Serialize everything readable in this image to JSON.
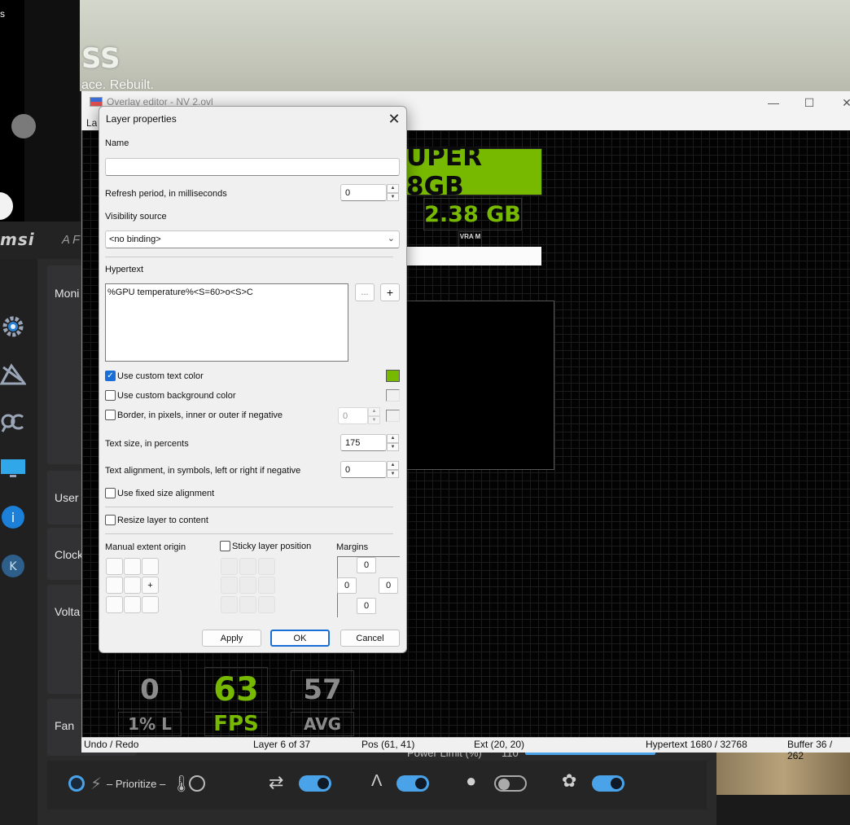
{
  "background": {
    "left_text": "s",
    "photo_title": "SS",
    "photo_subtitle": "ace. Rebuilt."
  },
  "msi": {
    "logo": "msi",
    "app_short": "AF",
    "sidebar_icons": [
      "gear-icon",
      "tool-icon",
      "search-icon",
      "monitor-icon",
      "info-icon",
      "k-icon"
    ],
    "cards": [
      "Moni",
      "User I",
      "Clock",
      "Volta",
      "Fan"
    ],
    "power_limit_label": "Power Limit (%)",
    "power_limit_value": "110",
    "prioritize_label": "– Prioritize –",
    "toggles": [
      true,
      true,
      false,
      true
    ],
    "accent": "#4aa3e8"
  },
  "overlay_editor": {
    "title": "Overlay editor - NV 2.ovl",
    "menu_label": "La",
    "window_buttons": [
      "minimize",
      "maximize",
      "close"
    ],
    "layers": {
      "super": "UPER 8GB",
      "gb": "2.38 GB",
      "vram": "VRA M",
      "stat_values": [
        "0",
        "63",
        "57"
      ],
      "stat_labels": [
        "1% L",
        "FPS",
        "AVG"
      ]
    },
    "status": {
      "undo_redo": "Undo / Redo",
      "layer": "Layer 6 of 37",
      "pos": "Pos (61, 41)",
      "ext": "Ext (20, 20)",
      "hypertext": "Hypertext 1680 / 32768",
      "buffer": "Buffer 36 / 262"
    },
    "accent_green": "#76b900"
  },
  "dialog": {
    "title": "Layer properties",
    "name_label": "Name",
    "name_value": "",
    "refresh_label": "Refresh period, in milliseconds",
    "refresh_value": "0",
    "visibility_label": "Visibility source",
    "visibility_value": "<no binding>",
    "hypertext_label": "Hypertext",
    "hypertext_value": "%GPU temperature%<S=60>o<S>C",
    "ellipsis_btn": "...",
    "plus_btn": "+",
    "custom_text_color_label": "Use custom text color",
    "custom_text_color_checked": true,
    "custom_text_color": "#76b900",
    "custom_bg_color_label": "Use custom background color",
    "border_label": "Border, in pixels, inner or outer if negative",
    "border_value": "0",
    "text_size_label": "Text size, in percents",
    "text_size_value": "175",
    "text_align_label": "Text alignment, in symbols, left or right if negative",
    "text_align_value": "0",
    "fixed_size_label": "Use fixed size alignment",
    "resize_label": "Resize layer to content",
    "extent_label": "Manual extent origin",
    "extent_center": "+",
    "sticky_label": "Sticky layer position",
    "margins_label": "Margins",
    "margins": {
      "top": "0",
      "left": "0",
      "right": "0",
      "bottom": "0"
    },
    "apply_label": "Apply",
    "ok_label": "OK",
    "cancel_label": "Cancel"
  }
}
